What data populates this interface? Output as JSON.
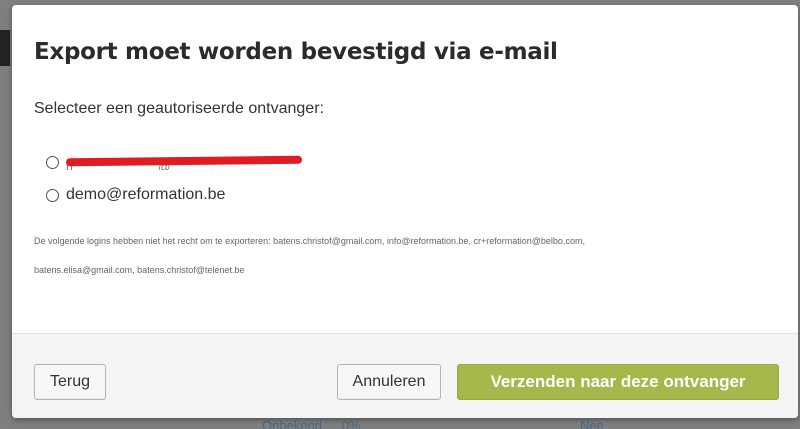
{
  "dialog": {
    "title": "Export moet worden bevestigd via e-mail",
    "prompt": "Selecteer een geautoriseerde ontvanger:",
    "recipients": [
      {
        "label": "[redacted]",
        "redacted": true,
        "selected": false
      },
      {
        "label": "demo@reformation.be",
        "redacted": false,
        "selected": false
      }
    ],
    "notice_line1": "De volgende logins hebben niet het recht om te exporteren: batens.christof@gmail.com, info@reformation.be, cr+reformation@belbo.com,",
    "notice_line2": "batens.elisa@gmail.com, batens.christof@telenet.be"
  },
  "footer": {
    "back_label": "Terug",
    "cancel_label": "Annuleren",
    "send_label": "Verzenden naar deze ontvanger"
  },
  "background": {
    "fragments": [
      "Onbekend",
      "0%",
      "Nee"
    ]
  },
  "colors": {
    "primary_button": "#a5b84c",
    "redaction": "#e01b24",
    "overlay": "#7d7f80"
  }
}
